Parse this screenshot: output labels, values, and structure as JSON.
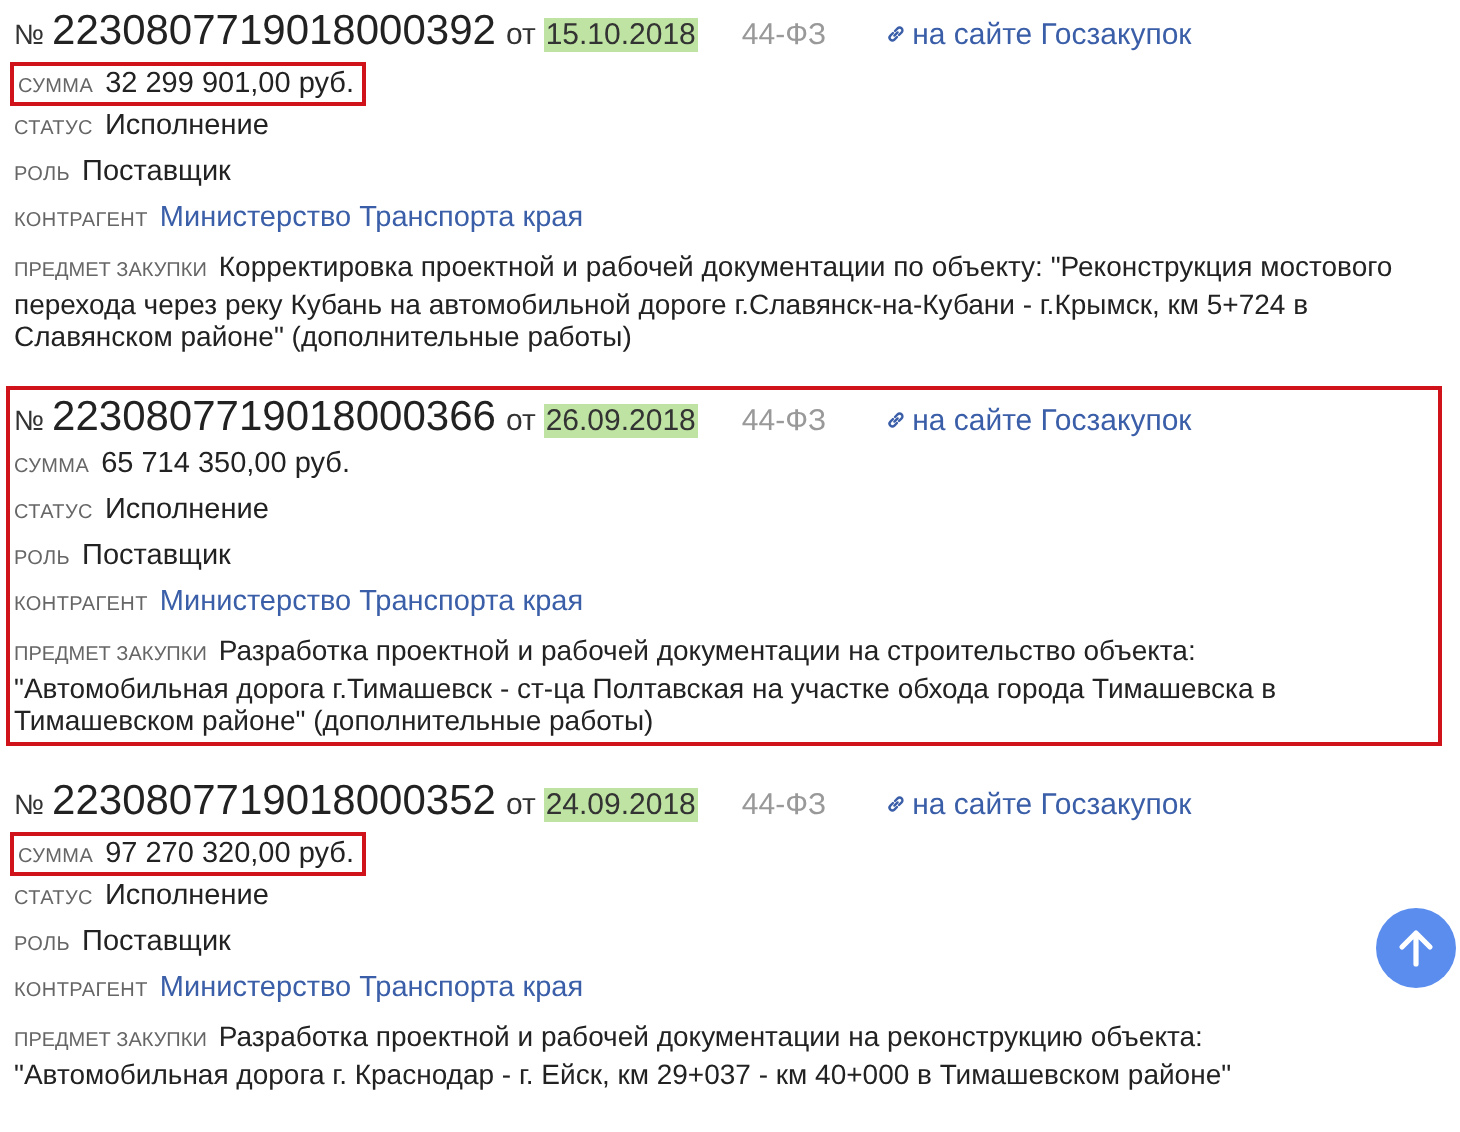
{
  "entries": [
    {
      "number_sign": "№",
      "number": "2230807719018000392",
      "date_prefix": "от",
      "date": "15.10.2018",
      "law": "44-ФЗ",
      "link": "на сайте Госзакупок",
      "highlighted": false,
      "fields": [
        {
          "kind": "text",
          "label": "СУММА",
          "value": "32 299 901,00 руб.",
          "highlighted": true
        },
        {
          "kind": "text",
          "label": "СТАТУС",
          "value": "Исполнение",
          "highlighted": false
        },
        {
          "kind": "text",
          "label": "РОЛЬ",
          "value": "Поставщик",
          "highlighted": false
        },
        {
          "kind": "link",
          "label": "КОНТРАГЕНТ",
          "value": "Министерство Транспорта края",
          "highlighted": false
        },
        {
          "kind": "long",
          "label": "ПРЕДМЕТ ЗАКУПКИ",
          "value": "Корректировка проектной и рабочей документации по объекту: \"Реконструкция мостового перехода через реку Кубань на автомобильной дороге г.Славянск-на-Кубани - г.Крымск, км 5+724 в Славянском районе\" (дополнительные работы)",
          "highlighted": false
        }
      ]
    },
    {
      "number_sign": "№",
      "number": "2230807719018000366",
      "date_prefix": "от",
      "date": "26.09.2018",
      "law": "44-ФЗ",
      "link": "на сайте Госзакупок",
      "highlighted": true,
      "fields": [
        {
          "kind": "text",
          "label": "СУММА",
          "value": "65 714 350,00 руб.",
          "highlighted": false
        },
        {
          "kind": "text",
          "label": "СТАТУС",
          "value": "Исполнение",
          "highlighted": false
        },
        {
          "kind": "text",
          "label": "РОЛЬ",
          "value": "Поставщик",
          "highlighted": false
        },
        {
          "kind": "link",
          "label": "КОНТРАГЕНТ",
          "value": "Министерство Транспорта края",
          "highlighted": false
        },
        {
          "kind": "long",
          "label": "ПРЕДМЕТ ЗАКУПКИ",
          "value": "Разработка проектной и рабочей документации на строительство объекта: \"Автомобильная дорога г.Тимашевск - ст-ца Полтавская на участке обхода города Тимашевска в Тимашевском районе\" (дополнительные работы)",
          "highlighted": false
        }
      ]
    },
    {
      "number_sign": "№",
      "number": "2230807719018000352",
      "date_prefix": "от",
      "date": "24.09.2018",
      "law": "44-ФЗ",
      "link": "на сайте Госзакупок",
      "highlighted": false,
      "fields": [
        {
          "kind": "text",
          "label": "СУММА",
          "value": "97 270 320,00 руб.",
          "highlighted": true
        },
        {
          "kind": "text",
          "label": "СТАТУС",
          "value": "Исполнение",
          "highlighted": false
        },
        {
          "kind": "text",
          "label": "РОЛЬ",
          "value": "Поставщик",
          "highlighted": false
        },
        {
          "kind": "link",
          "label": "КОНТРАГЕНТ",
          "value": "Министерство Транспорта края",
          "highlighted": false
        },
        {
          "kind": "long",
          "label": "ПРЕДМЕТ ЗАКУПКИ",
          "value": "Разработка проектной и рабочей документации на реконструкцию объекта: \"Автомобильная дорога г. Краснодар - г. Ейск, км 29+037 - км 40+000 в Тимашевском районе\"",
          "highlighted": false
        }
      ]
    }
  ]
}
